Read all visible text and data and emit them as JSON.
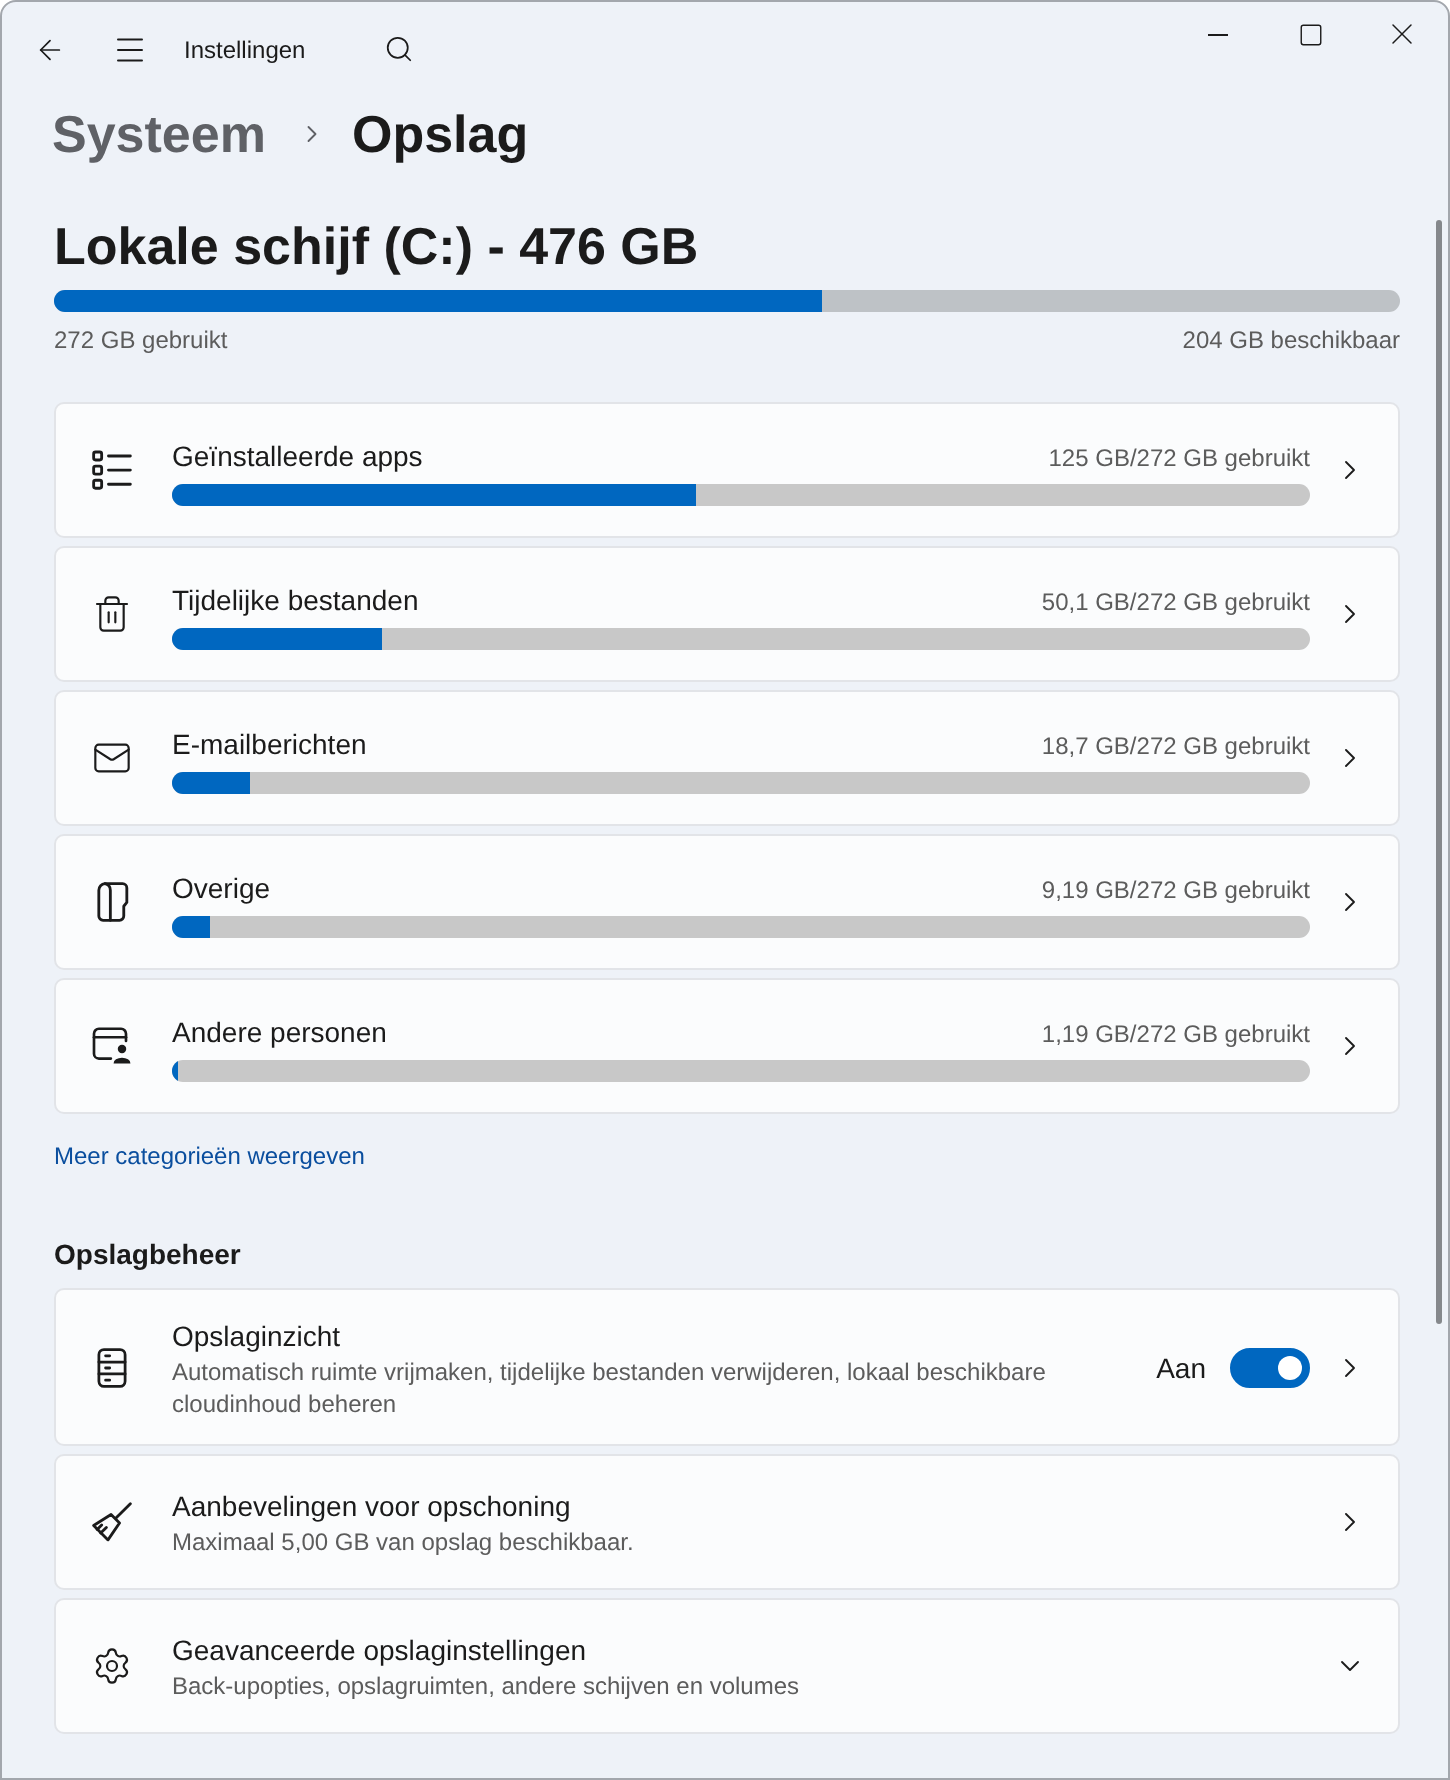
{
  "window": {
    "title": "Instellingen"
  },
  "breadcrumb": [
    {
      "label": "Systeem",
      "current": false
    },
    {
      "label": "Opslag",
      "current": true
    }
  ],
  "drive": {
    "title": "Lokale schijf (C:) - 476 GB",
    "level": 0.57,
    "used": "272 GB gebruikt",
    "free": "204 GB beschikbaar"
  },
  "categories": [
    {
      "name": "Geïnstalleerde apps",
      "usage": "125 GB/272 GB gebruikt",
      "level": 0.46
    },
    {
      "name": "Tijdelijke bestanden",
      "usage": "50,1 GB/272 GB gebruikt",
      "level": 0.184
    },
    {
      "name": "E-mailberichten",
      "usage": "18,7 GB/272 GB gebruikt",
      "level": 0.069
    },
    {
      "name": "Overige",
      "usage": "9,19 GB/272 GB gebruikt",
      "level": 0.034
    },
    {
      "name": "Andere personen",
      "usage": "1,19 GB/272 GB gebruikt",
      "level": 0.0044
    }
  ],
  "more_link": "Meer categorieën weergeven",
  "storage_management": {
    "heading": "Opslagbeheer",
    "items": [
      {
        "kind": "toggle",
        "title": "Opslaginzicht",
        "description": "Automatisch ruimte vrijmaken, tijdelijke bestanden verwijderen, lokaal beschikbare cloudinhoud beheren",
        "state_label": "Aan",
        "on": true
      },
      {
        "kind": "link",
        "title": "Aanbevelingen voor opschoning",
        "description": "Maximaal 5,00 GB van opslag beschikbaar."
      },
      {
        "kind": "expander",
        "title": "Geavanceerde opslaginstellingen",
        "description": "Back-upopties, opslagruimten, andere schijven en volumes",
        "expanded": false
      }
    ]
  }
}
